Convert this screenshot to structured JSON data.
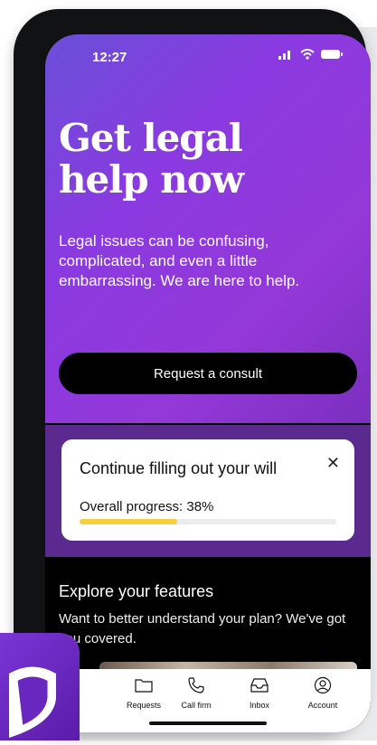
{
  "status": {
    "time": "12:27"
  },
  "hero": {
    "title_line1": "Get legal",
    "title_line2": "help now",
    "body": "Legal issues can be confusing, complicated, and even a little embarrassing. We are here to help.",
    "cta_label": "Request a consult"
  },
  "progress_card": {
    "title": "Continue filling out your will",
    "progress_label": "Overall progress: 38%",
    "progress_value": 0.38,
    "close_glyph": "✕"
  },
  "explore": {
    "title": "Explore your features",
    "subtitle": "Want to better understand your plan? We've got you covered."
  },
  "tabbar": {
    "items": [
      {
        "label": "Requests",
        "icon": "folder-icon"
      },
      {
        "label": "Call firm",
        "icon": "phone-icon"
      },
      {
        "label": "Inbox",
        "icon": "inbox-icon"
      },
      {
        "label": "Account",
        "icon": "account-icon"
      }
    ]
  },
  "colors": {
    "hero_start": "#6a4fd8",
    "hero_end": "#9438d8",
    "progress_band": "#5a2a8f",
    "progress_fill": "#f5d03a",
    "logo": "#7a35d6"
  }
}
